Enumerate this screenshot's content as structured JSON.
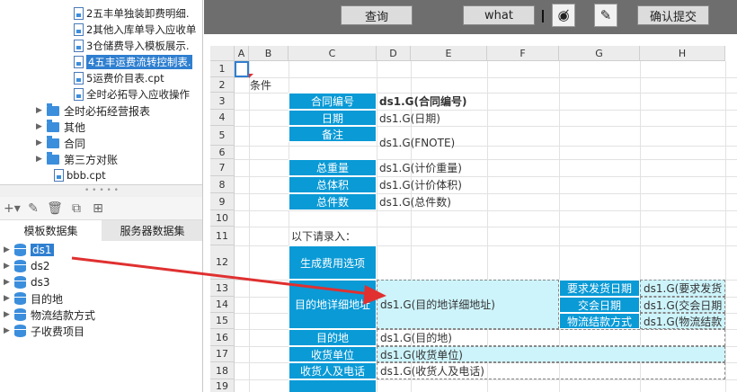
{
  "left_panel": {
    "files": [
      {
        "label": "2五丰单独装卸费明细.",
        "selected": false
      },
      {
        "label": "2其他入库单导入应收单",
        "selected": false
      },
      {
        "label": "3仓储费导入模板展示.",
        "selected": false
      },
      {
        "label": "4五丰运费流转控制表.",
        "selected": true
      },
      {
        "label": "5运费价目表.cpt",
        "selected": false
      },
      {
        "label": "全时必拓导入应收操作",
        "selected": false
      }
    ],
    "folders": [
      {
        "label": "全时必拓经营报表"
      },
      {
        "label": "其他"
      },
      {
        "label": "合同"
      },
      {
        "label": "第三方对账"
      }
    ],
    "bottom_file": "bbb.cpt",
    "tabs": {
      "template": "模板数据集",
      "server": "服务器数据集"
    },
    "datasets": [
      {
        "label": "ds1",
        "selected": true,
        "expandable": true
      },
      {
        "label": "ds2",
        "selected": false,
        "expandable": true
      },
      {
        "label": "ds3",
        "selected": false,
        "expandable": true
      },
      {
        "label": "目的地",
        "selected": false,
        "expandable": true
      },
      {
        "label": "物流结款方式",
        "selected": false,
        "expandable": true
      },
      {
        "label": "子收费项目",
        "selected": false,
        "expandable": true
      }
    ]
  },
  "topbar": {
    "query_label": "查询",
    "what_label": "what",
    "submit_label": "确认提交",
    "eye_icon": "eye-slash-icon",
    "pen_icon": "pen-icon"
  },
  "grid": {
    "columns": [
      "A",
      "B",
      "C",
      "D",
      "E",
      "F",
      "G",
      "H"
    ],
    "rows": [
      "1",
      "2",
      "3",
      "4",
      "5",
      "6",
      "7",
      "8",
      "9",
      "10",
      "11",
      "12",
      "13",
      "14",
      "15",
      "16",
      "17",
      "18",
      "19"
    ],
    "b2": "条件",
    "labels": {
      "contract_no": "合同编号",
      "date": "日期",
      "note": "备注",
      "total_weight": "总重量",
      "total_volume": "总体积",
      "total_pieces": "总件数",
      "gen_fee": "生成费用选项",
      "dest_address": "目的地详细地址",
      "req_ship_date": "要求发货日期",
      "delivery_date": "交会日期",
      "payment_method": "物流结款方式",
      "destination": "目的地",
      "consignee": "收货单位",
      "consignee_phone": "收货人及电话"
    },
    "values": {
      "contract_no": "ds1.G(合同编号)",
      "date": "ds1.G(日期)",
      "note": "ds1.G(FNOTE)",
      "total_weight": "ds1.G(计价重量)",
      "total_volume": "ds1.G(计价体积)",
      "total_pieces": "ds1.G(总件数)",
      "dest_address": "ds1.G(目的地详细地址)",
      "req_ship_date": "ds1.G(要求发货",
      "delivery_date": "ds1.G(交会日期",
      "payment_method": "ds1.G(物流结款",
      "destination": "ds1.G(目的地)",
      "consignee": "ds1.G(收货单位)",
      "consignee_phone": "ds1.G(收货人及电话)"
    },
    "section_title": "以下请录入："
  },
  "colors": {
    "label_bg": "#0a9ad6",
    "highlight": "#cdf4fb",
    "topbar": "#6e6e6e",
    "selection": "#2f7fd0",
    "arrow": "#e03030"
  }
}
